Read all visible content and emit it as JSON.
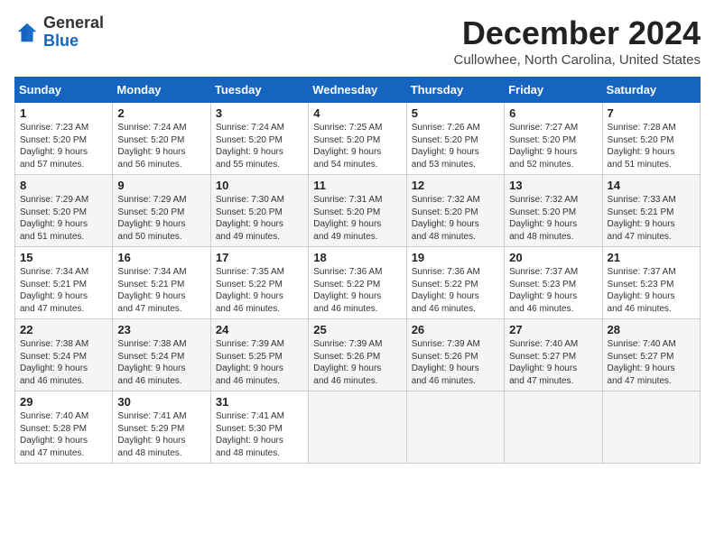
{
  "header": {
    "logo_line1": "General",
    "logo_line2": "Blue",
    "title": "December 2024",
    "subtitle": "Cullowhee, North Carolina, United States"
  },
  "weekdays": [
    "Sunday",
    "Monday",
    "Tuesday",
    "Wednesday",
    "Thursday",
    "Friday",
    "Saturday"
  ],
  "weeks": [
    [
      {
        "day": "1",
        "rise": "7:23 AM",
        "set": "5:20 PM",
        "daylight": "9 hours and 57 minutes."
      },
      {
        "day": "2",
        "rise": "7:24 AM",
        "set": "5:20 PM",
        "daylight": "9 hours and 56 minutes."
      },
      {
        "day": "3",
        "rise": "7:24 AM",
        "set": "5:20 PM",
        "daylight": "9 hours and 55 minutes."
      },
      {
        "day": "4",
        "rise": "7:25 AM",
        "set": "5:20 PM",
        "daylight": "9 hours and 54 minutes."
      },
      {
        "day": "5",
        "rise": "7:26 AM",
        "set": "5:20 PM",
        "daylight": "9 hours and 53 minutes."
      },
      {
        "day": "6",
        "rise": "7:27 AM",
        "set": "5:20 PM",
        "daylight": "9 hours and 52 minutes."
      },
      {
        "day": "7",
        "rise": "7:28 AM",
        "set": "5:20 PM",
        "daylight": "9 hours and 51 minutes."
      }
    ],
    [
      {
        "day": "8",
        "rise": "7:29 AM",
        "set": "5:20 PM",
        "daylight": "9 hours and 51 minutes."
      },
      {
        "day": "9",
        "rise": "7:29 AM",
        "set": "5:20 PM",
        "daylight": "9 hours and 50 minutes."
      },
      {
        "day": "10",
        "rise": "7:30 AM",
        "set": "5:20 PM",
        "daylight": "9 hours and 49 minutes."
      },
      {
        "day": "11",
        "rise": "7:31 AM",
        "set": "5:20 PM",
        "daylight": "9 hours and 49 minutes."
      },
      {
        "day": "12",
        "rise": "7:32 AM",
        "set": "5:20 PM",
        "daylight": "9 hours and 48 minutes."
      },
      {
        "day": "13",
        "rise": "7:32 AM",
        "set": "5:20 PM",
        "daylight": "9 hours and 48 minutes."
      },
      {
        "day": "14",
        "rise": "7:33 AM",
        "set": "5:21 PM",
        "daylight": "9 hours and 47 minutes."
      }
    ],
    [
      {
        "day": "15",
        "rise": "7:34 AM",
        "set": "5:21 PM",
        "daylight": "9 hours and 47 minutes."
      },
      {
        "day": "16",
        "rise": "7:34 AM",
        "set": "5:21 PM",
        "daylight": "9 hours and 47 minutes."
      },
      {
        "day": "17",
        "rise": "7:35 AM",
        "set": "5:22 PM",
        "daylight": "9 hours and 46 minutes."
      },
      {
        "day": "18",
        "rise": "7:36 AM",
        "set": "5:22 PM",
        "daylight": "9 hours and 46 minutes."
      },
      {
        "day": "19",
        "rise": "7:36 AM",
        "set": "5:22 PM",
        "daylight": "9 hours and 46 minutes."
      },
      {
        "day": "20",
        "rise": "7:37 AM",
        "set": "5:23 PM",
        "daylight": "9 hours and 46 minutes."
      },
      {
        "day": "21",
        "rise": "7:37 AM",
        "set": "5:23 PM",
        "daylight": "9 hours and 46 minutes."
      }
    ],
    [
      {
        "day": "22",
        "rise": "7:38 AM",
        "set": "5:24 PM",
        "daylight": "9 hours and 46 minutes."
      },
      {
        "day": "23",
        "rise": "7:38 AM",
        "set": "5:24 PM",
        "daylight": "9 hours and 46 minutes."
      },
      {
        "day": "24",
        "rise": "7:39 AM",
        "set": "5:25 PM",
        "daylight": "9 hours and 46 minutes."
      },
      {
        "day": "25",
        "rise": "7:39 AM",
        "set": "5:26 PM",
        "daylight": "9 hours and 46 minutes."
      },
      {
        "day": "26",
        "rise": "7:39 AM",
        "set": "5:26 PM",
        "daylight": "9 hours and 46 minutes."
      },
      {
        "day": "27",
        "rise": "7:40 AM",
        "set": "5:27 PM",
        "daylight": "9 hours and 47 minutes."
      },
      {
        "day": "28",
        "rise": "7:40 AM",
        "set": "5:27 PM",
        "daylight": "9 hours and 47 minutes."
      }
    ],
    [
      {
        "day": "29",
        "rise": "7:40 AM",
        "set": "5:28 PM",
        "daylight": "9 hours and 47 minutes."
      },
      {
        "day": "30",
        "rise": "7:41 AM",
        "set": "5:29 PM",
        "daylight": "9 hours and 48 minutes."
      },
      {
        "day": "31",
        "rise": "7:41 AM",
        "set": "5:30 PM",
        "daylight": "9 hours and 48 minutes."
      },
      null,
      null,
      null,
      null
    ]
  ]
}
